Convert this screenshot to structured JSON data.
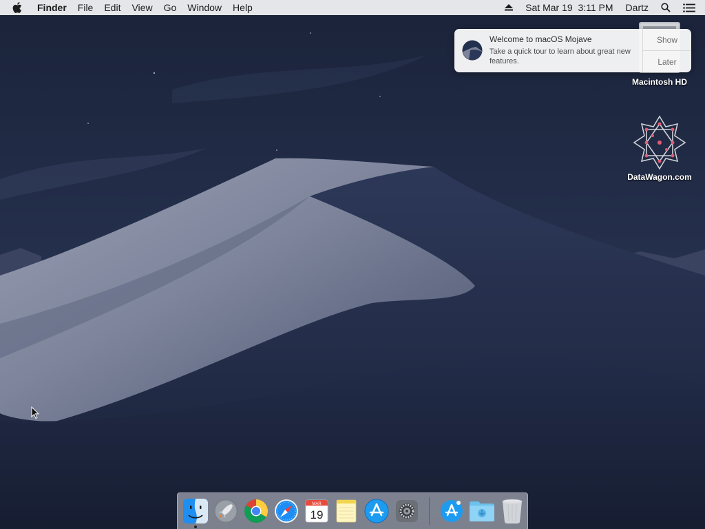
{
  "menubar": {
    "apple_icon": "apple-icon",
    "app_name": "Finder",
    "menus": [
      "File",
      "Edit",
      "View",
      "Go",
      "Window",
      "Help"
    ],
    "eject_icon": "eject-icon",
    "clock": "Sat Mar 19  3:11 PM",
    "user": "Dartz",
    "spotlight_icon": "spotlight-search-icon",
    "notification_center_icon": "notification-center-icon"
  },
  "notification": {
    "title": "Welcome to macOS Mojave",
    "body": "Take a quick tour to learn about great new features.",
    "show_label": "Show",
    "later_label": "Later"
  },
  "desktop": {
    "icons": [
      {
        "label": "Macintosh HD",
        "icon": "hard-drive-icon"
      },
      {
        "label": "DataWagon.com",
        "icon": "datawagon-logo-icon"
      }
    ]
  },
  "calendar_icon": {
    "month": "MAR",
    "day": "19"
  },
  "dock": {
    "apps": [
      "Finder",
      "Launchpad",
      "Google Chrome",
      "Safari",
      "Calendar",
      "Notes",
      "App Store",
      "System Preferences"
    ],
    "others": [
      "App Store Downloads",
      "Downloads",
      "Trash"
    ]
  },
  "colors": {
    "menubar_bg": "#ececee",
    "sky": "#1d2740",
    "dune_light": "#8e94a8",
    "dune_dark": "#24304f"
  }
}
